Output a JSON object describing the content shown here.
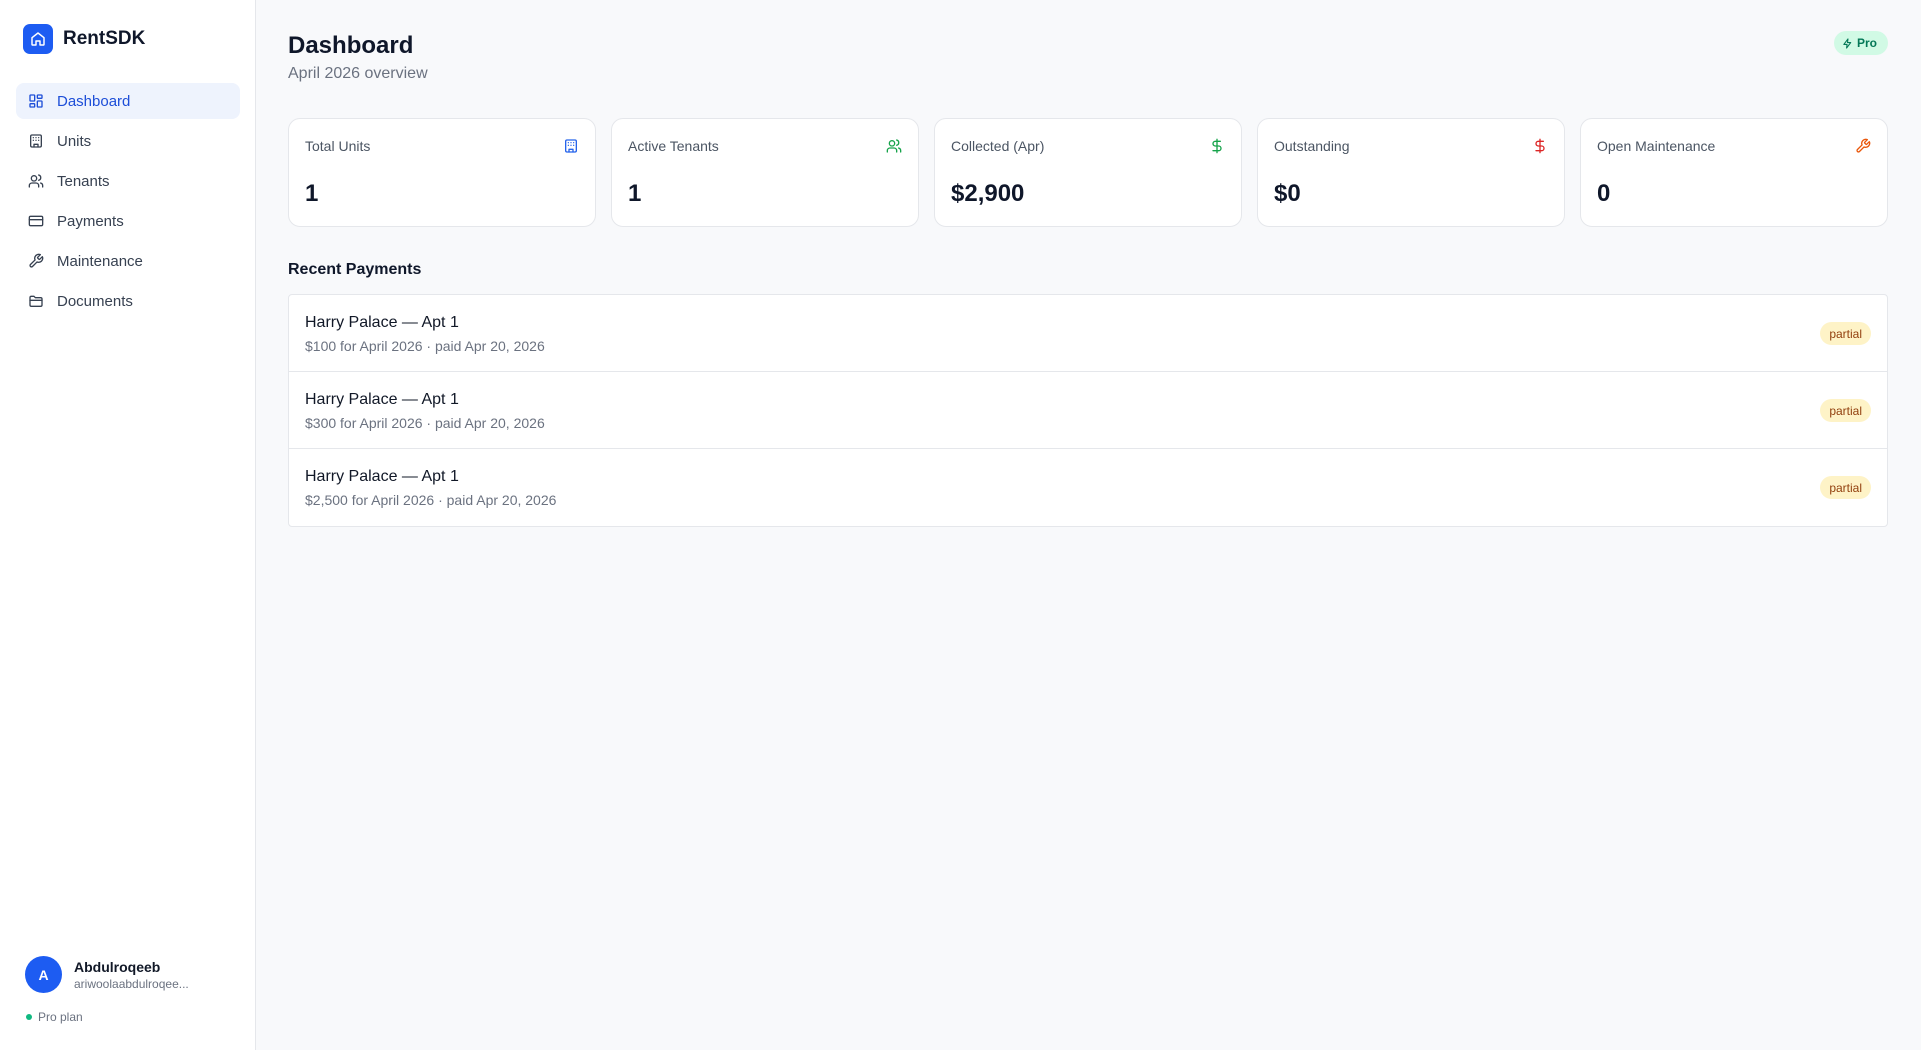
{
  "brand": {
    "name": "RentSDK",
    "color": "#1d5cf2"
  },
  "sidebar": {
    "items": [
      {
        "label": "Dashboard",
        "icon": "dashboard-icon",
        "active": true
      },
      {
        "label": "Units",
        "icon": "building-icon"
      },
      {
        "label": "Tenants",
        "icon": "users-icon"
      },
      {
        "label": "Payments",
        "icon": "credit-card-icon"
      },
      {
        "label": "Maintenance",
        "icon": "wrench-icon"
      },
      {
        "label": "Documents",
        "icon": "folder-icon"
      }
    ],
    "user": {
      "initial": "A",
      "name": "Abdulroqeeb",
      "email": "ariwoolaabdulroqee..."
    },
    "plan": "Pro plan"
  },
  "header": {
    "title": "Dashboard",
    "subtitle": "April 2026 overview",
    "badge": "Pro"
  },
  "stats": [
    {
      "label": "Total Units",
      "value": "1",
      "icon": "building-icon",
      "color": "#2563eb"
    },
    {
      "label": "Active Tenants",
      "value": "1",
      "icon": "users-icon",
      "color": "#16a34a"
    },
    {
      "label": "Collected (Apr)",
      "value": "$2,900",
      "icon": "dollar-icon",
      "color": "#16a34a"
    },
    {
      "label": "Outstanding",
      "value": "$0",
      "icon": "dollar-icon",
      "color": "#dc2626"
    },
    {
      "label": "Open Maintenance",
      "value": "0",
      "icon": "wrench-icon",
      "color": "#ea580c"
    }
  ],
  "recent_payments": {
    "title": "Recent Payments",
    "rows": [
      {
        "title": "Harry Palace — Apt 1",
        "detail": "$100 for April 2026 · paid Apr 20, 2026",
        "status": "partial"
      },
      {
        "title": "Harry Palace — Apt 1",
        "detail": "$300 for April 2026 · paid Apr 20, 2026",
        "status": "partial"
      },
      {
        "title": "Harry Palace — Apt 1",
        "detail": "$2,500 for April 2026 · paid Apr 20, 2026",
        "status": "partial"
      }
    ]
  }
}
